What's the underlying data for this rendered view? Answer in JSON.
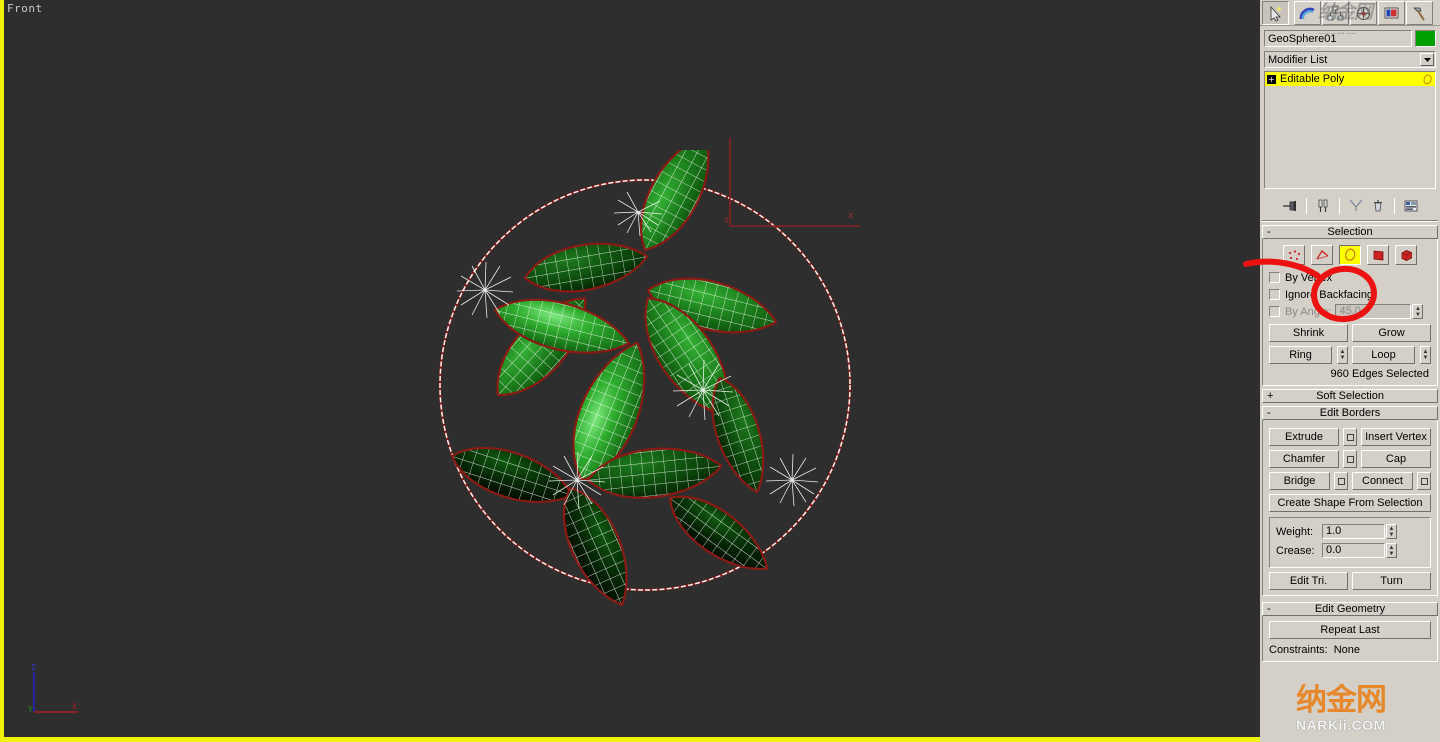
{
  "viewport": {
    "label": "Front",
    "active_border_color": "#f2f20c",
    "background_color": "#2e2e2e",
    "gizmo": {
      "axis_z_label": "z",
      "axis_x_label": "x",
      "color": "#8b2020"
    },
    "tripod": {
      "z_label": "Z",
      "y_label": "Y",
      "x_label": "X",
      "z_color": "#2222cc",
      "y_color": "#1e8b1e",
      "x_color": "#aa2020"
    },
    "model": {
      "name": "GeoSphere01",
      "surface_color": "#1f8f1f",
      "wireframe_color": "#ffffff",
      "selected_edge_color": "#8b1a14",
      "petals": 12
    }
  },
  "command_panel": {
    "tabs": [
      {
        "name": "create-tab",
        "icon": "arrow-cursor-icon",
        "selected": true
      },
      {
        "name": "modify-tab",
        "icon": "rainbow-arc-icon",
        "selected": false
      },
      {
        "name": "hierarchy-tab",
        "icon": "hierarchy-icon",
        "selected": false
      },
      {
        "name": "motion-tab",
        "icon": "wheel-icon",
        "selected": false
      },
      {
        "name": "display-tab",
        "icon": "display-monitor-icon",
        "selected": false
      },
      {
        "name": "utilities-tab",
        "icon": "hammer-icon",
        "selected": false
      }
    ],
    "object_name": "GeoSphere01",
    "object_color": "#00a000",
    "modifier_list_label": "Modifier List",
    "stack": [
      {
        "label": "Editable Poly",
        "expanded": true,
        "highlighted": true
      }
    ],
    "stack_tools": [
      {
        "name": "pin-stack-icon"
      },
      {
        "name": "show-end-result-icon"
      },
      {
        "name": "make-unique-icon"
      },
      {
        "name": "remove-modifier-icon"
      },
      {
        "name": "configure-modifier-sets-icon"
      }
    ],
    "rollouts": {
      "selection": {
        "title": "Selection",
        "sign": "-",
        "sub_object_levels": [
          {
            "name": "vertex",
            "icon": "vertex-dots-icon",
            "active": false
          },
          {
            "name": "edge",
            "icon": "edge-lines-icon",
            "active": false
          },
          {
            "name": "border",
            "icon": "border-loop-icon",
            "active": true
          },
          {
            "name": "polygon",
            "icon": "polygon-square-icon",
            "active": false
          },
          {
            "name": "element",
            "icon": "element-cube-icon",
            "active": false
          }
        ],
        "by_vertex_label": "By Vertex",
        "ignore_backfacing_label": "Ignore Backfacing",
        "by_angle_label": "By Angle:",
        "by_angle_value": "45.0",
        "shrink_label": "Shrink",
        "grow_label": "Grow",
        "ring_label": "Ring",
        "loop_label": "Loop",
        "selection_status": "960 Edges Selected"
      },
      "soft_selection": {
        "title": "Soft Selection",
        "sign": "+"
      },
      "edit_borders": {
        "title": "Edit Borders",
        "sign": "-",
        "extrude_label": "Extrude",
        "insert_vertex_label": "Insert Vertex",
        "chamfer_label": "Chamfer",
        "cap_label": "Cap",
        "bridge_label": "Bridge",
        "connect_label": "Connect",
        "create_shape_label": "Create Shape From Selection",
        "weight_label": "Weight:",
        "weight_value": "1.0",
        "crease_label": "Crease:",
        "crease_value": "0.0",
        "edit_tri_label": "Edit Tri.",
        "turn_label": "Turn"
      },
      "edit_geometry": {
        "title": "Edit Geometry",
        "sign": "-",
        "repeat_last_label": "Repeat Last",
        "constraints_label": "Constraints:",
        "constraints_value": "None"
      }
    }
  },
  "watermarks": {
    "top": {
      "text": "纳金网",
      "sub": "www.narkii.com"
    },
    "bottom": {
      "cn": "纳金网",
      "en": "NARKii.COM"
    }
  },
  "annotation": {
    "type": "hand-drawn-circle-with-arrow",
    "color": "#ee1111"
  }
}
